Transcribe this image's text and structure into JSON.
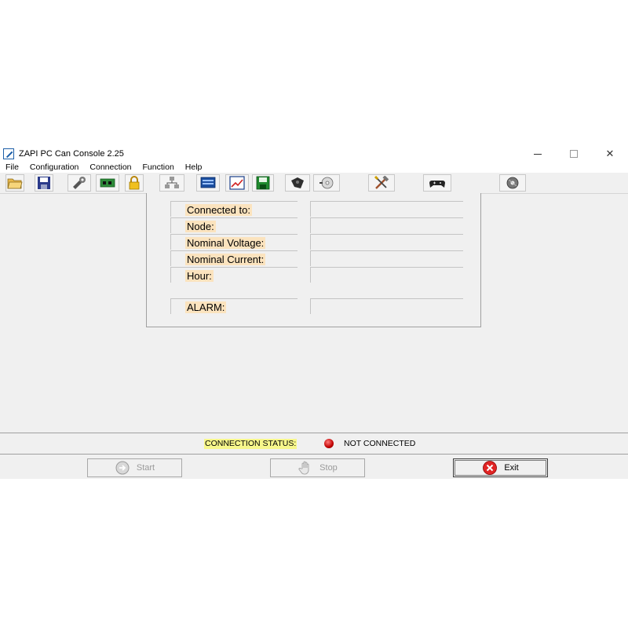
{
  "window": {
    "title": "ZAPI PC Can Console 2.25",
    "controls": {
      "minimize": "",
      "maximize": "",
      "close": "✕"
    }
  },
  "menu": [
    "File",
    "Configuration",
    "Connection",
    "Function",
    "Help"
  ],
  "toolbar": {
    "buttons": [
      {
        "icon": "open-folder-icon"
      },
      {
        "icon": "save-disk-icon"
      },
      {
        "icon": "tools-wrench-icon"
      },
      {
        "icon": "circuit-board-icon"
      },
      {
        "icon": "padlock-icon"
      },
      {
        "icon": "network-icon"
      },
      {
        "icon": "monitor-icon"
      },
      {
        "icon": "chart-icon"
      },
      {
        "icon": "green-disk-icon"
      },
      {
        "icon": "motor-icon"
      },
      {
        "icon": "cd-icon"
      },
      {
        "icon": "hammer-screwdriver-icon"
      },
      {
        "icon": "gamepad-icon"
      },
      {
        "icon": "disc-icon"
      }
    ]
  },
  "info": {
    "connected_to": {
      "label": "Connected to:",
      "value": ""
    },
    "node": {
      "label": "Node:",
      "value": ""
    },
    "nominal_voltage": {
      "label": "Nominal Voltage:",
      "value": ""
    },
    "nominal_current": {
      "label": "Nominal Current:",
      "value": ""
    },
    "hour": {
      "label": "Hour:",
      "value": ""
    },
    "alarm": {
      "label": "ALARM:",
      "value": ""
    }
  },
  "status": {
    "label": "CONNECTION STATUS:",
    "value": "NOT CONNECTED",
    "led_color": "#c00000"
  },
  "buttons": {
    "start": "Start",
    "stop": "Stop",
    "exit": "Exit"
  }
}
